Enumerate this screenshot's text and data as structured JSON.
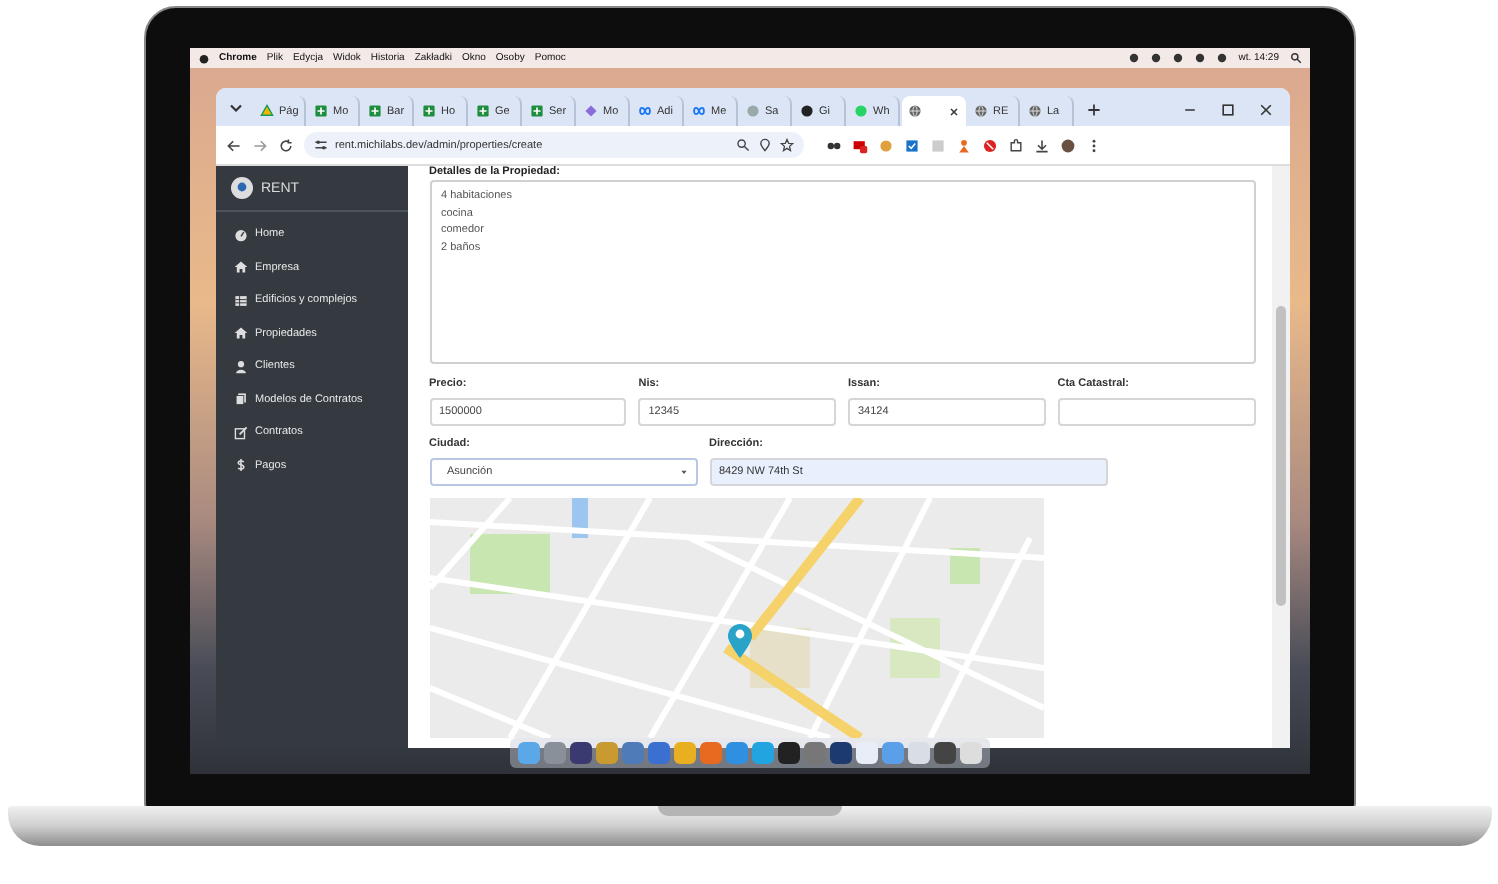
{
  "menu_bar": {
    "items": [
      "Chrome",
      "Plik",
      "Edycja",
      "Widok",
      "Historia",
      "Zakładki",
      "Okno",
      "Osoby",
      "Pomoc"
    ],
    "clock": "wt. 14:29"
  },
  "tabs": [
    {
      "label": "Pág",
      "selected": false
    },
    {
      "label": "Mo",
      "selected": false
    },
    {
      "label": "Bar",
      "selected": false
    },
    {
      "label": "Ho",
      "selected": false
    },
    {
      "label": "Ge",
      "selected": false
    },
    {
      "label": "Ser",
      "selected": false
    },
    {
      "label": "Mo",
      "selected": false
    },
    {
      "label": "Adi",
      "selected": false
    },
    {
      "label": "Me",
      "selected": false
    },
    {
      "label": "Sa",
      "selected": false
    },
    {
      "label": "Gi",
      "selected": false
    },
    {
      "label": "Wh",
      "selected": false
    },
    {
      "selected": true
    },
    {
      "label": "RE",
      "selected": false
    },
    {
      "label": "La",
      "selected": false
    }
  ],
  "address_bar": {
    "url": "rent.michilabs.dev/admin/properties/create"
  },
  "sidebar": {
    "brand": "RENT",
    "items": [
      "Home",
      "Empresa",
      "Edificios y complejos",
      "Propiedades",
      "Clientes",
      "Modelos de Contratos",
      "Contratos",
      "Pagos"
    ]
  },
  "form": {
    "description_label": "Detalles de la Propiedad:",
    "description": "4 habitaciones\ncocina\ncomedor\n2 baños",
    "fields": [
      {
        "label": "Precio:",
        "value": "1500000"
      },
      {
        "label": "Nis:",
        "value": "12345"
      },
      {
        "label": "Issan:",
        "value": "34124"
      },
      {
        "label": "Cta Catastral:"
      }
    ],
    "city": {
      "label": "Ciudad:",
      "value": "Asunción"
    },
    "address": {
      "label": "Dirección:",
      "value": "8429 NW 74th St"
    }
  }
}
